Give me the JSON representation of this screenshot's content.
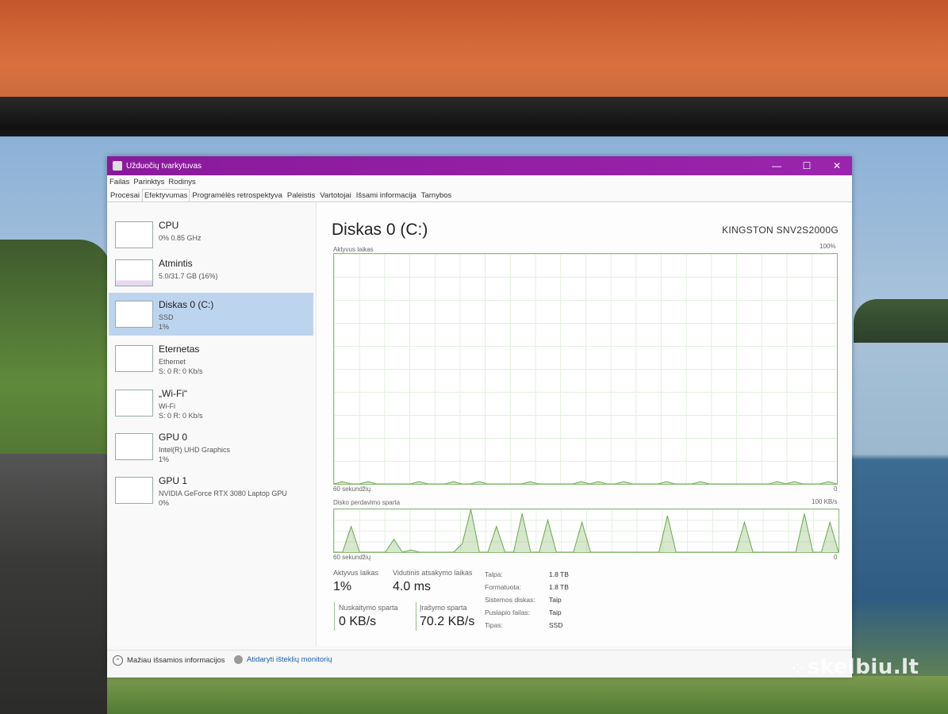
{
  "window": {
    "title": "Užduočių tvarkytuvas",
    "controls": {
      "minimize": "—",
      "maximize": "☐",
      "close": "✕"
    }
  },
  "menu": [
    "Failas",
    "Parinktys",
    "Rodinys"
  ],
  "tabs": [
    {
      "label": "Procesai",
      "active": false
    },
    {
      "label": "Efektyvumas",
      "active": true
    },
    {
      "label": "Programėlės retrospektyva",
      "active": false
    },
    {
      "label": "Paleistis",
      "active": false
    },
    {
      "label": "Vartotojai",
      "active": false
    },
    {
      "label": "Išsami informacija",
      "active": false
    },
    {
      "label": "Tarnybos",
      "active": false
    }
  ],
  "sidebar": {
    "items": [
      {
        "name": "CPU",
        "sub1": "0% 0.85 GHz",
        "sub2": "",
        "selected": false
      },
      {
        "name": "Atmintis",
        "sub1": "5.0/31.7 GB (16%)",
        "sub2": "",
        "selected": false
      },
      {
        "name": "Diskas 0 (C:)",
        "sub1": "SSD",
        "sub2": "1%",
        "selected": true
      },
      {
        "name": "Eternetas",
        "sub1": "Ethernet",
        "sub2": "S: 0 R: 0 Kb/s",
        "selected": false
      },
      {
        "name": "„Wi-Fi“",
        "sub1": "Wi-Fi",
        "sub2": "S: 0 R: 0 Kb/s",
        "selected": false
      },
      {
        "name": "GPU 0",
        "sub1": "Intel(R) UHD Graphics",
        "sub2": "1%",
        "selected": false
      },
      {
        "name": "GPU 1",
        "sub1": "NVIDIA GeForce RTX 3080 Laptop GPU",
        "sub2": "0%",
        "selected": false
      }
    ]
  },
  "main": {
    "title": "Diskas 0 (C:)",
    "model": "KINGSTON SNV2S2000G",
    "graph1": {
      "label": "Aktyvus laikas",
      "max": "100%",
      "time": "60 sekundžių",
      "min": "0"
    },
    "graph2": {
      "label": "Disko perdavimo sparta",
      "max": "100 KB/s",
      "time": "60 sekundžių",
      "min": "0"
    },
    "stats": {
      "active_label": "Aktyvus laikas",
      "active_value": "1%",
      "response_label": "Vidutinis atsakymo laikas",
      "response_value": "4.0 ms",
      "read_label": "Nuskaitymo sparta",
      "read_value": "0 KB/s",
      "write_label": "Įrašymo sparta",
      "write_value": "70.2 KB/s"
    },
    "props": [
      {
        "k": "Talpa:",
        "v": "1.8 TB"
      },
      {
        "k": "Formatuota:",
        "v": "1.8 TB"
      },
      {
        "k": "Sistemos diskas:",
        "v": "Taip"
      },
      {
        "k": "Puslapio failas:",
        "v": "Taip"
      },
      {
        "k": "Tipas:",
        "v": "SSD"
      }
    ]
  },
  "chart_data": [
    {
      "type": "area",
      "title": "Aktyvus laikas",
      "ylim": [
        0,
        100
      ],
      "x_label": "60 sekundžių",
      "values": [
        0,
        1,
        0,
        0,
        1,
        0,
        0,
        0,
        0,
        0,
        1,
        0,
        0,
        0,
        1,
        0,
        0,
        1,
        0,
        0,
        0,
        0,
        0,
        1,
        0,
        0,
        0,
        0,
        0,
        1,
        0,
        1,
        0,
        0,
        1,
        0,
        0,
        0,
        0,
        1,
        0,
        0,
        0,
        1,
        0,
        0,
        0,
        0,
        0,
        0,
        0,
        0,
        1,
        0,
        1,
        0,
        0,
        0,
        1,
        0
      ]
    },
    {
      "type": "line",
      "title": "Disko perdavimo sparta",
      "ylim": [
        0,
        100
      ],
      "ylabel": "KB/s",
      "x_label": "60 sekundžių",
      "values": [
        0,
        0,
        60,
        0,
        0,
        0,
        0,
        30,
        0,
        5,
        0,
        0,
        0,
        0,
        0,
        20,
        100,
        0,
        0,
        60,
        0,
        0,
        90,
        0,
        0,
        75,
        0,
        0,
        0,
        70,
        0,
        0,
        0,
        0,
        0,
        0,
        0,
        0,
        0,
        85,
        0,
        0,
        0,
        0,
        0,
        0,
        0,
        0,
        70,
        0,
        0,
        0,
        0,
        0,
        0,
        90,
        0,
        0,
        70,
        0
      ]
    }
  ]
}
